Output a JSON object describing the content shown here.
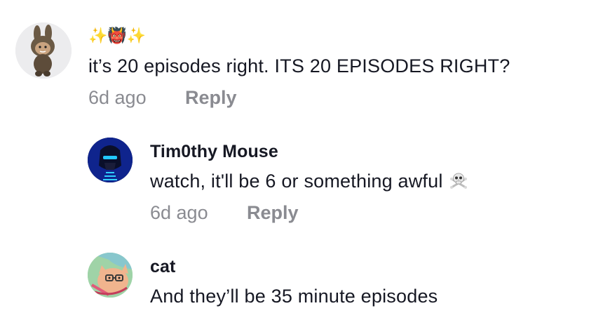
{
  "comments": [
    {
      "username": "✨👹✨",
      "text": "it’s 20 episodes right. ITS 20 EPISODES RIGHT?",
      "time": "6d ago",
      "reply_label": "Reply",
      "avatar_icon": "plush-bunny-avatar"
    },
    {
      "username": "Tim0thy Mouse",
      "text": "watch, it'll be 6 or something awful",
      "trailing_emoji": "skull-crossbones-icon",
      "time": "6d ago",
      "reply_label": "Reply",
      "avatar_icon": "blue-neon-portrait-avatar"
    },
    {
      "username": "cat",
      "text": "And they’ll be 35 minute episodes",
      "avatar_icon": "cartoon-cat-avatar"
    }
  ],
  "colors": {
    "text": "#161823",
    "muted": "#8a8b91"
  }
}
